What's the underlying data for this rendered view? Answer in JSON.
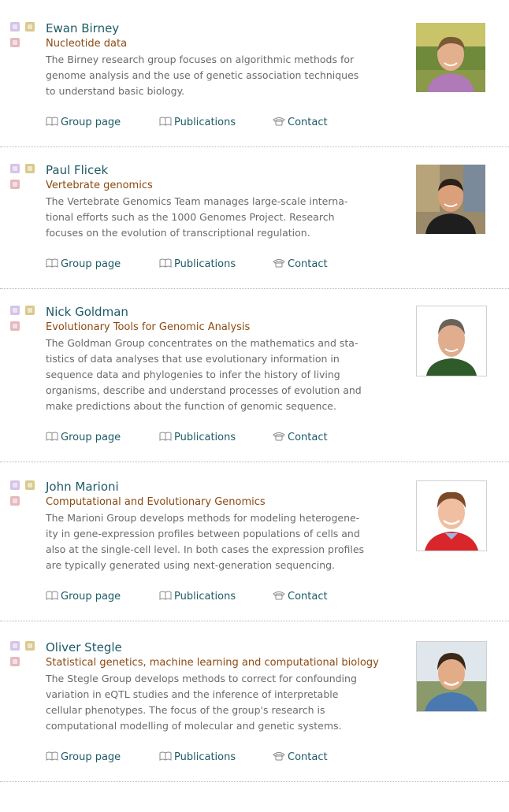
{
  "entries": [
    {
      "name": "Ewan Birney",
      "topic": "Nucleotide data",
      "desc_lines": [
        "The Birney research group focuses on algorithmic methods for",
        "genome analysis and the use of genetic association techniques",
        "to understand basic biology."
      ]
    },
    {
      "name": "Paul Flicek",
      "topic": "Vertebrate genomics",
      "desc_lines": [
        "The Vertebrate Genomics Team manages large-scale interna-",
        "tional efforts such as the 1000 Genomes Project. Research",
        "focuses on the evolution of transcriptional regulation."
      ]
    },
    {
      "name": "Nick Goldman",
      "topic": "Evolutionary Tools for Genomic Analysis",
      "desc_lines": [
        "The Goldman Group concentrates on the mathematics and sta-",
        "tistics of data analyses that use evolutionary information in",
        "sequence data and phylogenies to infer the history of living",
        "organisms, describe and understand processes of evolution and",
        "make predictions about the function of genomic sequence."
      ]
    },
    {
      "name": "John Marioni",
      "topic": "Computational and Evolutionary Genomics",
      "desc_lines": [
        "The Marioni Group develops methods for modeling heterogene-",
        "ity in gene-expression profiles between populations of cells and",
        "also at the single-cell level. In both cases the expression profiles",
        "are typically generated using next-generation sequencing."
      ]
    },
    {
      "name": "Oliver Stegle",
      "topic": "Statistical genetics, machine learning and computational biology",
      "desc_lines": [
        "The Stegle Group develops methods to correct for confounding",
        "variation in eQTL studies and the inference of interpretable",
        "cellular phenotypes. The focus of the group's research is",
        "computational modelling of molecular and genetic systems."
      ]
    }
  ],
  "links": {
    "group_page": "Group page",
    "publications": "Publications",
    "contact": "Contact"
  },
  "colors": {
    "name": "#1d5a66",
    "topic": "#8a4a12",
    "text": "#6a6a6a",
    "link": "#1d5a66"
  },
  "icons": {
    "book": "book-icon",
    "phone": "phone-icon"
  }
}
